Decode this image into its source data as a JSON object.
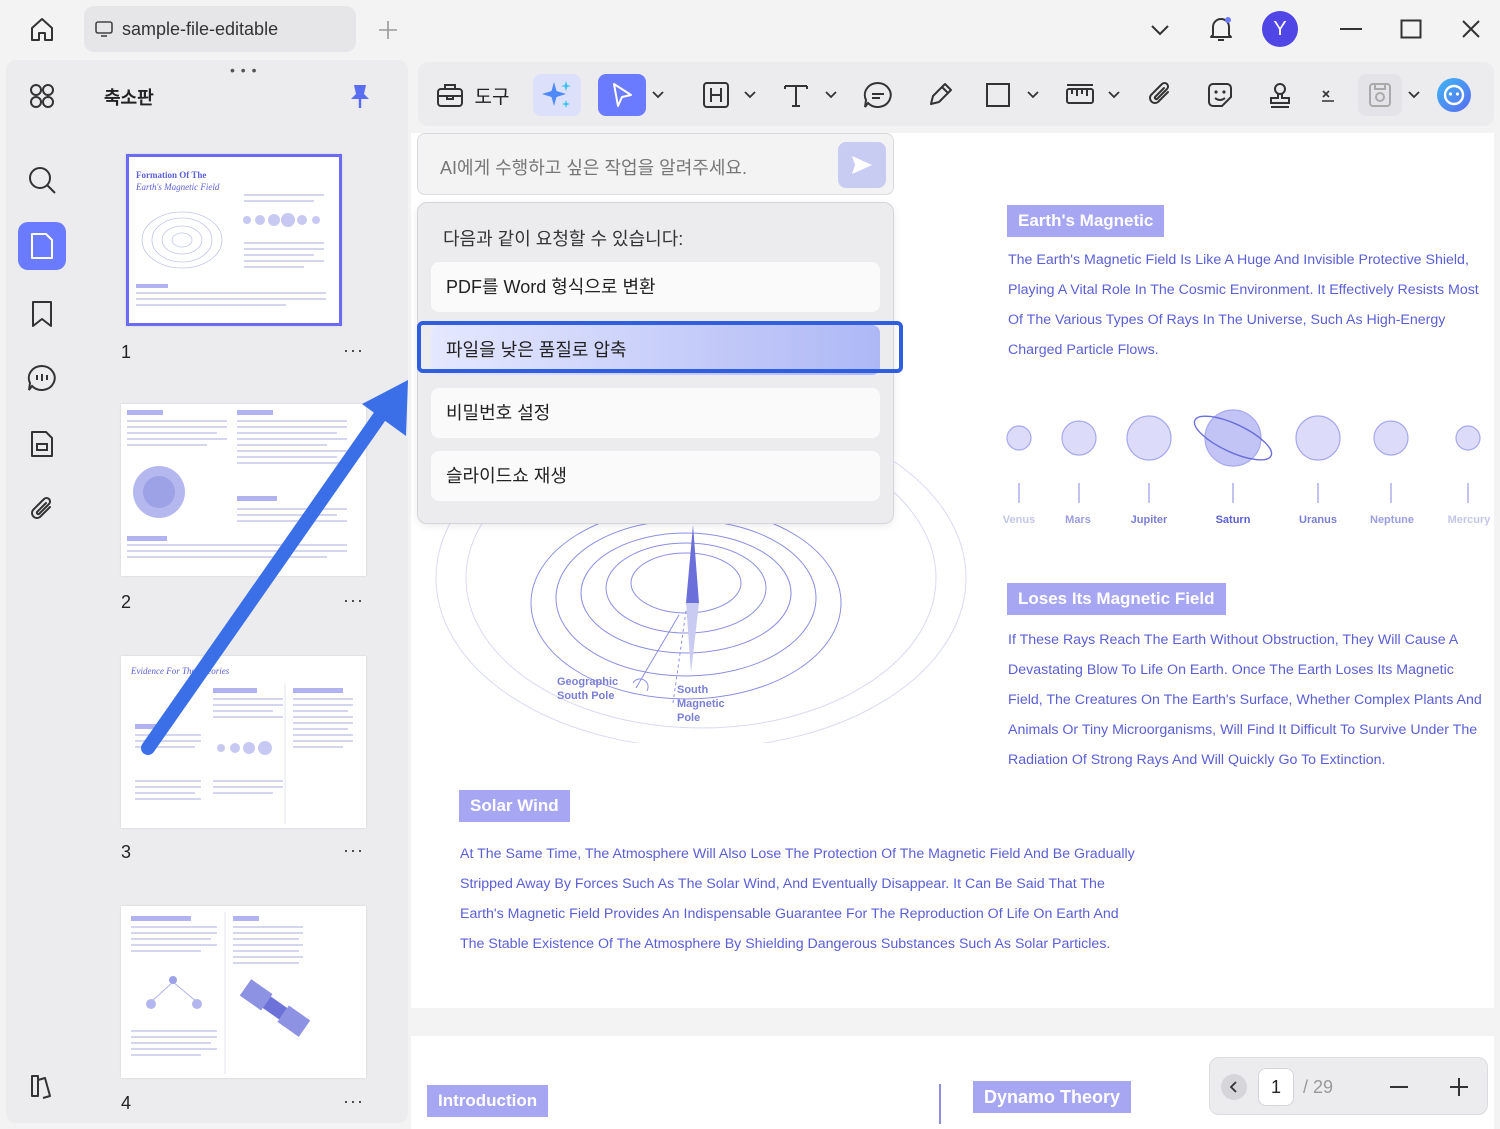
{
  "window": {
    "tab_title": "sample-file-editable",
    "avatar_letter": "Y"
  },
  "sidebar": {
    "panel_title": "축소판",
    "thumbnails": [
      {
        "number": "1",
        "heading": "Formation Of The",
        "subheading": "Earth's Magnetic Field",
        "more": "···"
      },
      {
        "number": "2",
        "more": "···"
      },
      {
        "number": "3",
        "heading": "Evidence For The Theories",
        "more": "···"
      },
      {
        "number": "4",
        "more": "···"
      }
    ]
  },
  "toolbar": {
    "tools_label": "도구"
  },
  "ai": {
    "placeholder": "AI에게 수행하고 싶은 작업을 알려주세요.",
    "suggestions_heading": "다음과 같이 요청할 수 있습니다:",
    "suggestions": [
      "PDF를 Word 형식으로 변환",
      "파일을 낮은 품질로 압축",
      "비밀번호 설정",
      "슬라이드쇼 재생"
    ]
  },
  "document": {
    "section1_title": "Earth's Magnetic",
    "section1_lines": [
      "The Earth's Magnetic Field Is Like A Huge And Invisible Protective Shield,",
      "Playing A Vital Role In The Cosmic Environment. It Effectively Resists Most",
      "Of The Various Types Of Rays In The Universe, Such As High-Energy",
      "Charged Particle Flows."
    ],
    "planets": [
      "Venus",
      "Mars",
      "Jupiter",
      "Saturn",
      "Uranus",
      "Neptune",
      "Mercury"
    ],
    "diagram_label_geo": [
      "Geographic",
      "South Pole"
    ],
    "diagram_label_mag": [
      "South",
      "Magnetic",
      "Pole"
    ],
    "section2_title": "Loses Its Magnetic Field",
    "section2_lines": [
      "If These Rays Reach The Earth Without Obstruction, They Will Cause A",
      "Devastating Blow To Life On Earth. Once The Earth Loses Its Magnetic",
      "Field, The Creatures On The Earth's Surface, Whether Complex Plants And",
      "Animals Or Tiny Microorganisms, Will Find It Difficult To Survive Under The",
      "Radiation Of Strong Rays And Will Quickly Go To Extinction."
    ],
    "section3_title": "Solar Wind",
    "section3_lines": [
      "At The Same Time, The Atmosphere Will Also Lose The Protection Of The Magnetic Field And Be Gradually",
      "Stripped Away By Forces Such As The Solar Wind, And Eventually Disappear. It Can Be Said That The",
      "Earth's Magnetic Field Provides An Indispensable Guarantee For The Reproduction Of Life On Earth And",
      "The Stable Existence Of The Atmosphere By Shielding Dangerous Substances Such As Solar Particles."
    ],
    "next_page_left_title": "Introduction",
    "next_page_right_title": "Dynamo Theory"
  },
  "pager": {
    "current_page": "1",
    "total_pages": "/ 29"
  },
  "colors": {
    "accent": "#6b7bff",
    "doc_text": "#5b5fd6",
    "section_bg": "#a6a6f2",
    "highlight_frame": "#2f5fe0",
    "arrow": "#3b6fe8"
  }
}
